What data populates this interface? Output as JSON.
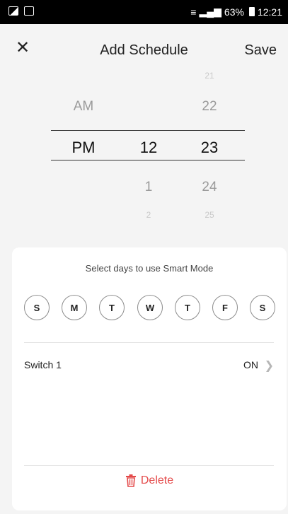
{
  "statusbar": {
    "signal_text": "63%",
    "time": "12:21"
  },
  "header": {
    "close_icon": "✕",
    "title": "Add Schedule",
    "save_label": "Save"
  },
  "picker": {
    "ampm": {
      "above": "AM",
      "selected": "PM"
    },
    "hour": {
      "selected": "12",
      "below": "1"
    },
    "minute": {
      "far_above": "21",
      "above": "22",
      "selected": "23",
      "below": "24",
      "far_below": "25"
    },
    "hour_far_below": "2"
  },
  "card": {
    "hint": "Select days to use Smart Mode",
    "days": [
      "S",
      "M",
      "T",
      "W",
      "T",
      "F",
      "S"
    ],
    "switch_label": "Switch 1",
    "switch_value": "ON",
    "delete_label": "Delete"
  },
  "colors": {
    "accent_delete": "#e44a4a",
    "background": "#f4f4f4"
  }
}
